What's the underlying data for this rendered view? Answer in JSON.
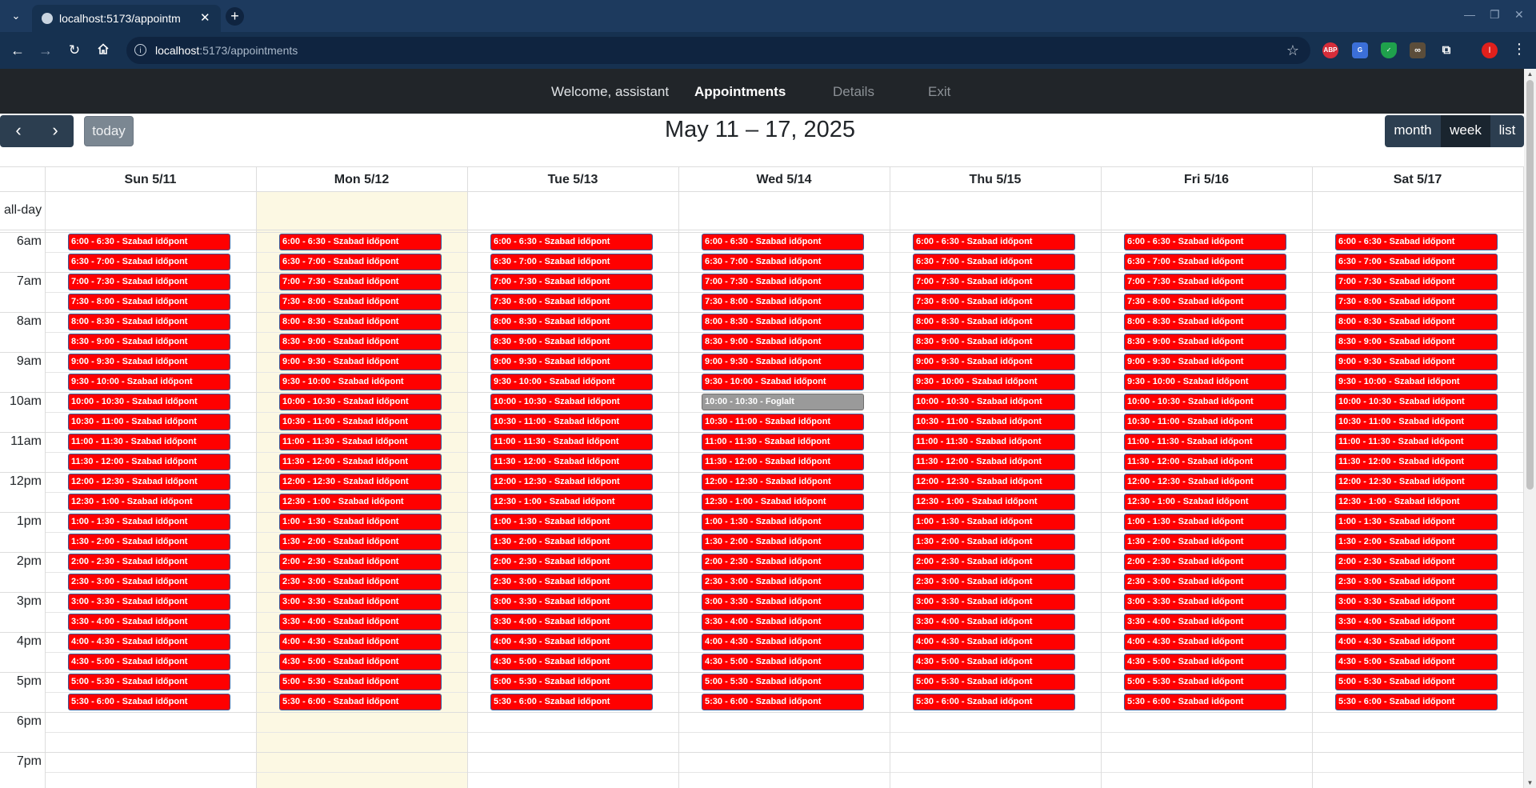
{
  "browser": {
    "tab_title": "localhost:5173/appointm",
    "url_host": "localhost",
    "url_path": ":5173/appointments",
    "tab_close": "✕",
    "new_tab": "+",
    "profile_initial": "I",
    "icons": [
      "tab-list-icon",
      "back-arrow-icon",
      "forward-arrow-icon",
      "reload-icon",
      "home-icon",
      "site-info-icon",
      "bookmark-star-icon",
      "adblock-extension-icon",
      "translate-extension-icon",
      "shield-extension-icon",
      "glasses-extension-icon",
      "extensions-puzzle-icon",
      "profile-avatar",
      "browser-menu-icon"
    ]
  },
  "nav": {
    "welcome": "Welcome, assistant",
    "appointments": "Appointments",
    "details": "Details",
    "exit": "Exit"
  },
  "calendar": {
    "title": "May 11 – 17, 2025",
    "today_button": "today",
    "views": {
      "month": "month",
      "week": "week",
      "list": "list"
    },
    "active_view": "week",
    "allday_label": "all-day",
    "days": [
      "Sun 5/11",
      "Mon 5/12",
      "Tue 5/13",
      "Wed 5/14",
      "Thu 5/15",
      "Fri 5/16",
      "Sat 5/17"
    ],
    "today_day": "Mon 5/12",
    "time_labels": [
      "6am",
      "7am",
      "8am",
      "9am",
      "10am",
      "11am",
      "12pm",
      "1pm",
      "2pm",
      "3pm",
      "4pm",
      "5pm",
      "6pm",
      "7pm"
    ],
    "slot_ranges": [
      "6:00 - 6:30",
      "6:30 - 7:00",
      "7:00 - 7:30",
      "7:30 - 8:00",
      "8:00 - 8:30",
      "8:30 - 9:00",
      "9:00 - 9:30",
      "9:30 - 10:00",
      "10:00 - 10:30",
      "10:30 - 11:00",
      "11:00 - 11:30",
      "11:30 - 12:00",
      "12:00 - 12:30",
      "12:30 - 1:00",
      "1:00 - 1:30",
      "1:30 - 2:00",
      "2:00 - 2:30",
      "2:30 - 3:00",
      "3:00 - 3:30",
      "3:30 - 4:00",
      "4:00 - 4:30",
      "4:30 - 5:00",
      "5:00 - 5:30",
      "5:30 - 6:00"
    ],
    "free_label": "Szabad időpont",
    "booked_label": "Foglalt",
    "booked_slots": [
      {
        "day": "Wed 5/14",
        "range": "10:00 - 10:30"
      }
    ],
    "colors": {
      "free": "#ff0000",
      "booked": "#9a9a9a",
      "today_bg": "#fcf8e3",
      "toolbar_button": "#2c3e50",
      "navbar": "#212529"
    }
  }
}
